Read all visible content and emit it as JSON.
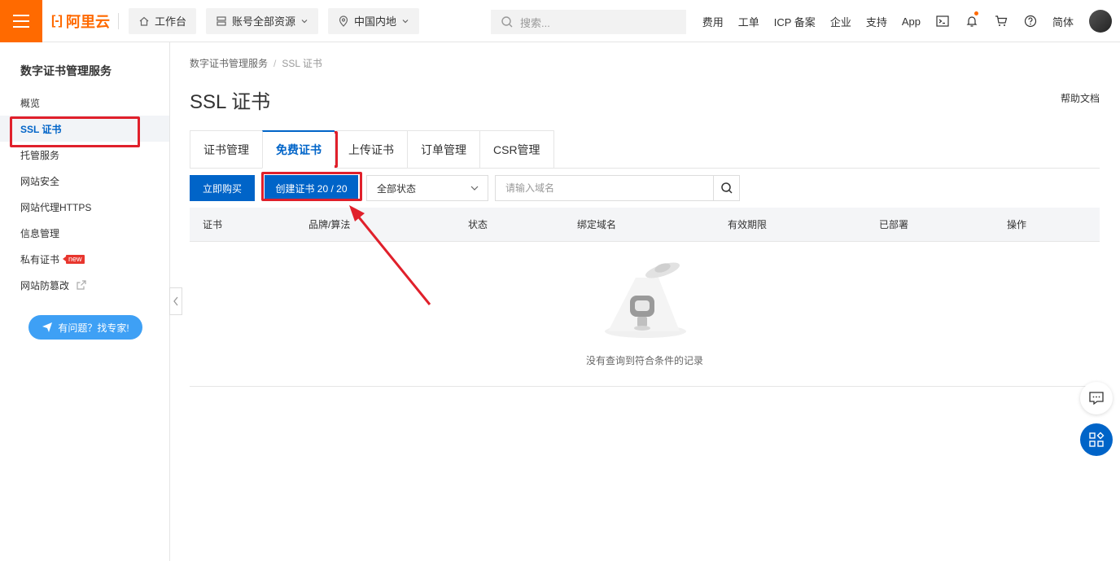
{
  "topbar": {
    "brand": "阿里云",
    "workbench": "工作台",
    "account_resources": "账号全部资源",
    "region": "中国内地",
    "search_placeholder": "搜索...",
    "links": [
      "费用",
      "工单",
      "ICP 备案",
      "企业",
      "支持",
      "App"
    ],
    "lang": "简体"
  },
  "sidebar": {
    "title": "数字证书管理服务",
    "items": [
      {
        "label": "概览"
      },
      {
        "label": "SSL 证书",
        "active": true
      },
      {
        "label": "托管服务"
      },
      {
        "label": "网站安全"
      },
      {
        "label": "网站代理HTTPS"
      },
      {
        "label": "信息管理"
      },
      {
        "label": "私有证书",
        "badge": "new"
      },
      {
        "label": "网站防篡改"
      }
    ],
    "expert_button": "有问题？找专家!"
  },
  "breadcrumb": [
    "数字证书管理服务",
    "SSL 证书"
  ],
  "page_title": "SSL 证书",
  "help_doc": "帮助文档",
  "tabs": [
    {
      "label": "证书管理"
    },
    {
      "label": "免费证书",
      "active": true
    },
    {
      "label": "上传证书"
    },
    {
      "label": "订单管理"
    },
    {
      "label": "CSR管理"
    }
  ],
  "toolbar": {
    "buy_button": "立即购买",
    "create_button": "创建证书 20 / 20",
    "status_select": "全部状态",
    "domain_placeholder": "请输入域名"
  },
  "table": {
    "columns": [
      "证书",
      "品牌/算法",
      "状态",
      "绑定域名",
      "有效期限",
      "已部署",
      "操作"
    ],
    "empty_text": "没有查询到符合条件的记录"
  },
  "colors": {
    "brand_orange": "#ff6a00",
    "primary_blue": "#0064c8",
    "annotation_red": "#e0202b"
  }
}
